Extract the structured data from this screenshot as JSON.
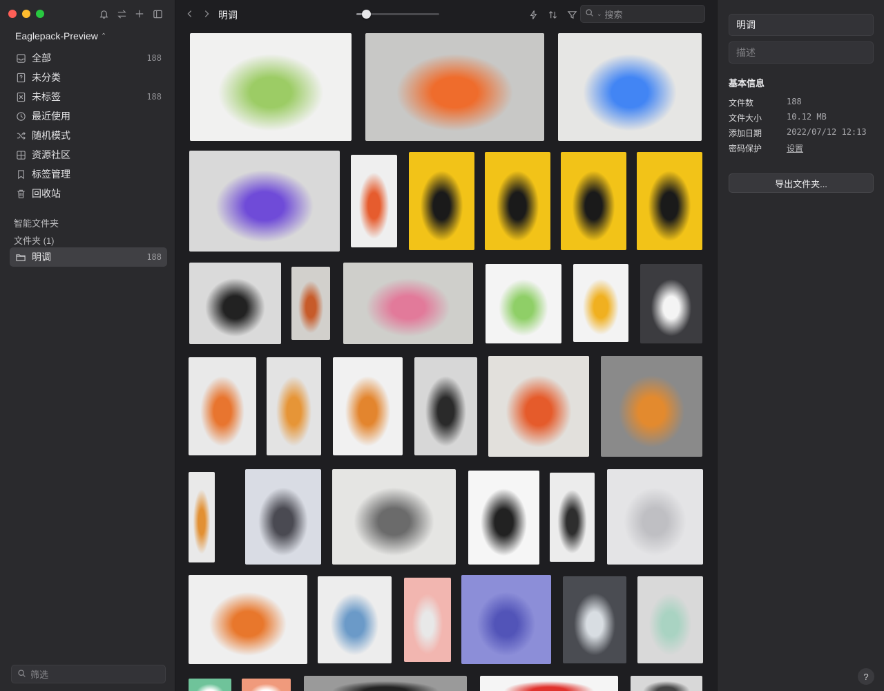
{
  "sidebar": {
    "library_name": "Eaglepack-Preview",
    "items": [
      {
        "label": "全部",
        "count": "188",
        "icon": "inbox-icon"
      },
      {
        "label": "未分类",
        "count": "",
        "icon": "question-box-icon"
      },
      {
        "label": "未标签",
        "count": "188",
        "icon": "untagged-icon"
      },
      {
        "label": "最近使用",
        "count": "",
        "icon": "clock-icon"
      },
      {
        "label": "随机模式",
        "count": "",
        "icon": "shuffle-icon"
      },
      {
        "label": "资源社区",
        "count": "",
        "icon": "grid-icon"
      },
      {
        "label": "标签管理",
        "count": "",
        "icon": "bookmark-icon"
      },
      {
        "label": "回收站",
        "count": "",
        "icon": "trash-icon"
      }
    ],
    "smart_folders_title": "智能文件夹",
    "folders_title": "文件夹 (1)",
    "active_folder": {
      "label": "明调",
      "count": "188"
    },
    "filter_placeholder": "筛选"
  },
  "toolbar": {
    "title": "明调",
    "search_placeholder": "搜索",
    "thumbnail_size_fraction": 0.12
  },
  "grid": {
    "thumbnails": [
      {
        "name": "thumb-spice-grinder",
        "color": "#f1f1f0",
        "accent": "#9ccc65"
      },
      {
        "name": "thumb-white-cube-device",
        "color": "#c8c8c6",
        "accent": "#ef6c2c"
      },
      {
        "name": "thumb-retro-computer",
        "color": "#e6e6e4",
        "accent": "#4285f4"
      },
      {
        "name": "thumb-game-controllers",
        "color": "#d9d9d9",
        "accent": "#6f4bd8"
      },
      {
        "name": "thumb-handheld-device",
        "color": "#efefef",
        "accent": "#e65c2e"
      },
      {
        "name": "thumb-headphones-1",
        "color": "#f2c318",
        "accent": "#1a1a1a"
      },
      {
        "name": "thumb-headphones-2",
        "color": "#f2c318",
        "accent": "#1a1a1a"
      },
      {
        "name": "thumb-headphones-3",
        "color": "#f2c318",
        "accent": "#1a1a1a"
      },
      {
        "name": "thumb-headphones-4",
        "color": "#f2c318",
        "accent": "#1a1a1a"
      },
      {
        "name": "thumb-gamepad",
        "color": "#dadada",
        "accent": "#222222"
      },
      {
        "name": "thumb-desk-objects",
        "color": "#d2d0cc",
        "accent": "#c75b2a"
      },
      {
        "name": "thumb-modular-kit",
        "color": "#cfcfcb",
        "accent": "#e27a9a"
      },
      {
        "name": "thumb-modular-stack",
        "color": "#f4f4f4",
        "accent": "#8fcf67"
      },
      {
        "name": "thumb-sony-walkman",
        "color": "#f3f3f3",
        "accent": "#f0b020"
      },
      {
        "name": "thumb-bottle",
        "color": "#3c3c40",
        "accent": "#f4f4f4"
      },
      {
        "name": "thumb-orange-case",
        "color": "#e9e9e9",
        "accent": "#e8752f"
      },
      {
        "name": "thumb-robot-arm-1",
        "color": "#e3e3e3",
        "accent": "#e69537"
      },
      {
        "name": "thumb-robot-arm-2",
        "color": "#f1f1f1",
        "accent": "#e3852e"
      },
      {
        "name": "thumb-hanging-cube",
        "color": "#d7d7d7",
        "accent": "#2a2a2a"
      },
      {
        "name": "thumb-ski-boot",
        "color": "#e2e0dc",
        "accent": "#e55b2b"
      },
      {
        "name": "thumb-radio-gadget",
        "color": "#8a8a8a",
        "accent": "#e38a2e"
      },
      {
        "name": "thumb-robot-arm-3",
        "color": "#e9e9e9",
        "accent": "#e29033"
      },
      {
        "name": "thumb-helmet-robot",
        "color": "#d9dce4",
        "accent": "#4a4a52"
      },
      {
        "name": "thumb-face-mask",
        "color": "#e5e5e3",
        "accent": "#6b6b6b"
      },
      {
        "name": "thumb-earbud",
        "color": "#f6f6f6",
        "accent": "#222222"
      },
      {
        "name": "thumb-speaker",
        "color": "#ececec",
        "accent": "#2e2e2e"
      },
      {
        "name": "thumb-watch",
        "color": "#e4e4e6",
        "accent": "#bfbfc3"
      },
      {
        "name": "thumb-floating-parts",
        "color": "#efefef",
        "accent": "#e8772c"
      },
      {
        "name": "thumb-watch-bands",
        "color": "#ededed",
        "accent": "#6b9ac8"
      },
      {
        "name": "thumb-pink-device",
        "color": "#f2b6b0",
        "accent": "#e8e8e8"
      },
      {
        "name": "thumb-purple-keyboard",
        "color": "#8c8ed8",
        "accent": "#5254b8"
      },
      {
        "name": "thumb-glass-block",
        "color": "#4a4c52",
        "accent": "#d8dde2"
      },
      {
        "name": "thumb-charging-pads",
        "color": "#d9d9d9",
        "accent": "#a9d3c2"
      },
      {
        "name": "thumb-mint-partial",
        "color": "#6fc39a",
        "accent": "#ffffff"
      },
      {
        "name": "thumb-salmon-partial",
        "color": "#f09a7c",
        "accent": "#ffffff"
      },
      {
        "name": "thumb-dark-partial",
        "color": "#9a9a9a",
        "accent": "#222222"
      },
      {
        "name": "thumb-red-partial",
        "color": "#f5f5f5",
        "accent": "#e0322c"
      },
      {
        "name": "thumb-grey-partial",
        "color": "#d8d8d8",
        "accent": "#444444"
      }
    ]
  },
  "inspector": {
    "title": "明调",
    "description_placeholder": "描述",
    "section_title": "基本信息",
    "rows": [
      {
        "key": "文件数",
        "value": "188"
      },
      {
        "key": "文件大小",
        "value": "10.12 MB"
      },
      {
        "key": "添加日期",
        "value": "2022/07/12 12:13"
      },
      {
        "key": "密码保护",
        "value": "设置"
      }
    ],
    "export_label": "导出文件夹...",
    "help_label": "?"
  }
}
